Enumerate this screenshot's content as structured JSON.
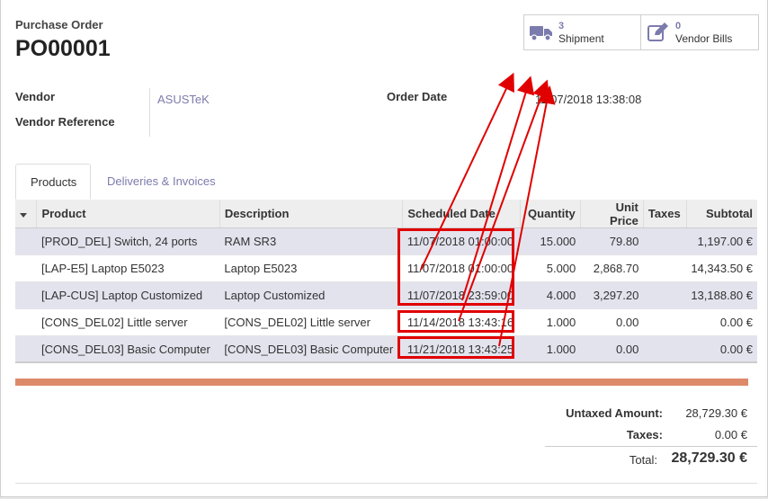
{
  "header": {
    "doc_type": "Purchase Order",
    "name": "PO00001"
  },
  "smart_buttons": {
    "shipment": {
      "count": "3",
      "label": "Shipment",
      "icon": "truck-icon"
    },
    "vendor_bills": {
      "count": "0",
      "label": "Vendor Bills",
      "icon": "pencil-square-icon"
    }
  },
  "fields": {
    "vendor_label": "Vendor",
    "vendor_value": "ASUSTeK",
    "vendor_ref_label": "Vendor Reference",
    "order_date_label": "Order Date",
    "order_date_value": "11/07/2018 13:38:08"
  },
  "tabs": [
    "Products",
    "Deliveries & Invoices"
  ],
  "table": {
    "columns": [
      "Product",
      "Description",
      "Scheduled Date",
      "Quantity",
      "Unit Price",
      "Taxes",
      "Subtotal"
    ],
    "rows": [
      {
        "product": "[PROD_DEL] Switch, 24 ports",
        "description": "RAM SR3",
        "date": "11/07/2018 01:00:00",
        "qty": "15.000",
        "price": "79.80",
        "taxes": "",
        "subtotal": "1,197.00 €"
      },
      {
        "product": "[LAP-E5] Laptop E5023",
        "description": "Laptop E5023",
        "date": "11/07/2018 01:00:00",
        "qty": "5.000",
        "price": "2,868.70",
        "taxes": "",
        "subtotal": "14,343.50 €"
      },
      {
        "product": "[LAP-CUS] Laptop Customized",
        "description": "Laptop Customized",
        "date": "11/07/2018 23:59:00",
        "qty": "4.000",
        "price": "3,297.20",
        "taxes": "",
        "subtotal": "13,188.80 €"
      },
      {
        "product": "[CONS_DEL02] Little server",
        "description": "[CONS_DEL02] Little server",
        "date": "11/14/2018 13:43:16",
        "qty": "1.000",
        "price": "0.00",
        "taxes": "",
        "subtotal": "0.00 €"
      },
      {
        "product": "[CONS_DEL03] Basic Computer",
        "description": "[CONS_DEL03] Basic Computer",
        "date": "11/21/2018 13:43:25",
        "qty": "1.000",
        "price": "0.00",
        "taxes": "",
        "subtotal": "0.00 €"
      }
    ]
  },
  "totals": {
    "untaxed_label": "Untaxed Amount:",
    "untaxed_value": "28,729.30 €",
    "taxes_label": "Taxes:",
    "taxes_value": "0.00 €",
    "total_label": "Total:",
    "total_value": "28,729.30 €"
  },
  "colors": {
    "accent": "#7c7bad",
    "annotation": "#e00000",
    "progress": "#dd8a6a"
  }
}
